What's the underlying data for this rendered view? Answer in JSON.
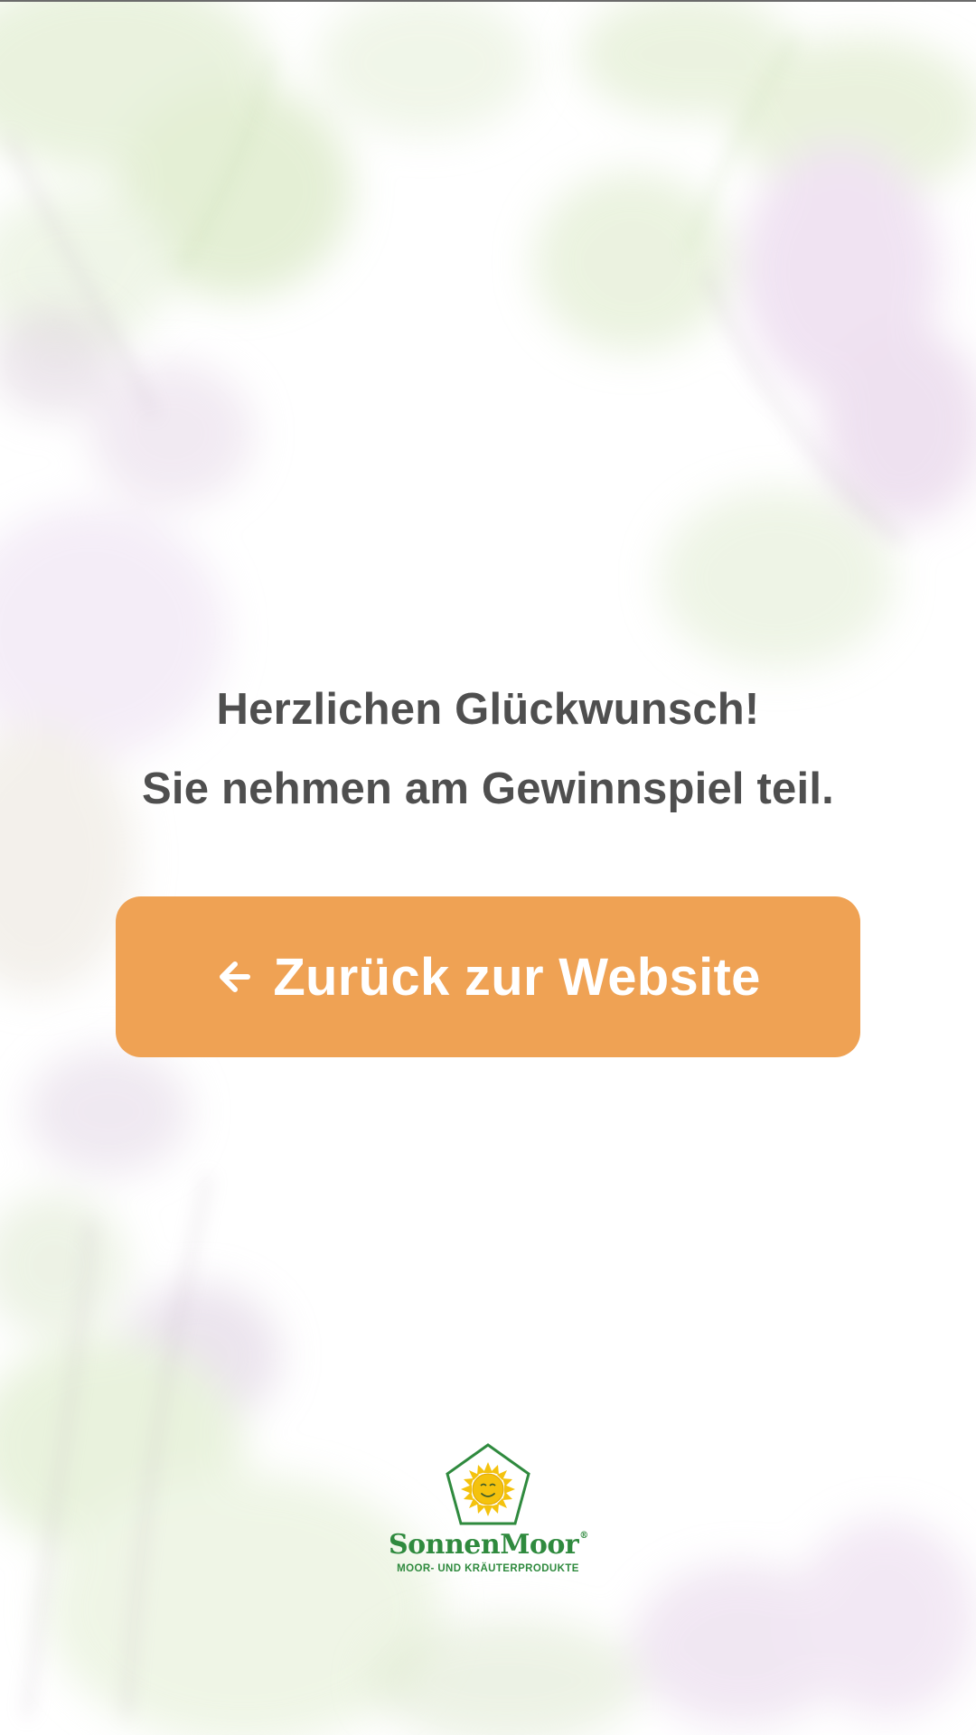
{
  "headline": {
    "line1": "Herzlichen Glückwunsch!",
    "line2": "Sie nehmen am Gewinnspiel teil."
  },
  "cta": {
    "icon": "arrow-left-icon",
    "label": "Zurück zur Website"
  },
  "brand": {
    "name": "SonnenMoor",
    "registered": "®",
    "tagline": "MOOR- UND KRÄUTERPRODUKTE",
    "logo_icon": "sun-pentagon-logo-icon"
  },
  "colors": {
    "accent": "#efa254",
    "text": "#4f4f4f",
    "brand_green": "#2f8a3e",
    "sun_yellow": "#f4c20d"
  }
}
